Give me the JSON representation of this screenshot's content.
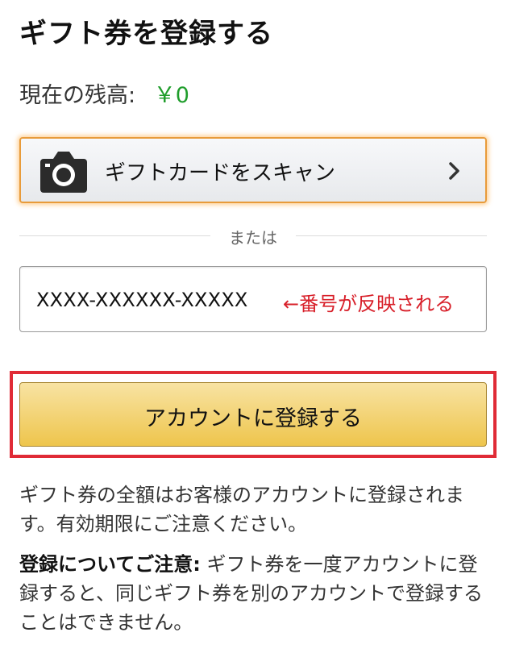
{
  "title": "ギフト券を登録する",
  "balance": {
    "label": "現在の残高:",
    "amount": "￥0",
    "amount_color": "#1f9d2b"
  },
  "scan_button": {
    "icon": "camera-icon",
    "label": "ギフトカードをスキャン",
    "chevron_icon": "chevron-right-icon"
  },
  "divider": {
    "text": "または"
  },
  "claim_code_field": {
    "value": "XXXX-XXXXXX-XXXXX",
    "annotation": "←番号が反映される",
    "annotation_color": "#d8202a"
  },
  "register_button": {
    "label": "アカウントに登録する"
  },
  "info_text": "ギフト券の全額はお客様のアカウントに登録されます。有効期限にご注意ください。",
  "caution": {
    "heading": "登録についてご注意:",
    "body": "ギフト券を一度アカウントに登録すると、同じギフト券を別のアカウントで登録することはできません。"
  },
  "highlight_color": "#e02b36",
  "accent_color": "#eec54c"
}
